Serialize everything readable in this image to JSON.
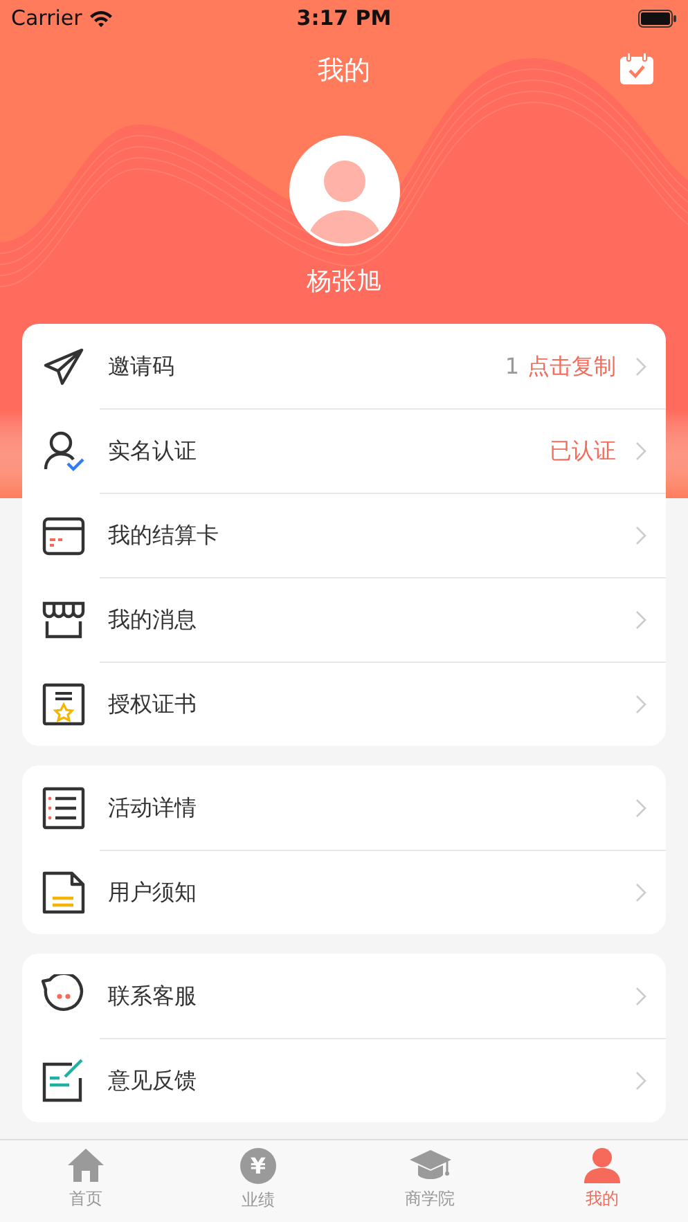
{
  "status_bar": {
    "carrier": "Carrier",
    "time": "3:17 PM"
  },
  "header": {
    "title": "我的",
    "user_name": "杨张旭"
  },
  "groups": [
    {
      "items": [
        {
          "kind": "send",
          "label": "邀请码",
          "values": [
            {
              "text": "1",
              "accent": false
            },
            {
              "text": "点击复制",
              "accent": true
            }
          ]
        },
        {
          "kind": "verify",
          "label": "实名认证",
          "values": [
            {
              "text": "已认证",
              "accent": true
            }
          ]
        },
        {
          "kind": "card",
          "label": "我的结算卡"
        },
        {
          "kind": "shop",
          "label": "我的消息"
        },
        {
          "kind": "cert",
          "label": "授权证书"
        }
      ]
    },
    {
      "items": [
        {
          "kind": "list",
          "label": "活动详情"
        },
        {
          "kind": "doc",
          "label": "用户须知"
        }
      ]
    },
    {
      "items": [
        {
          "kind": "chat",
          "label": "联系客服"
        },
        {
          "kind": "edit",
          "label": "意见反馈"
        }
      ]
    }
  ],
  "tab_bar": [
    {
      "kind": "home",
      "label": "首页",
      "selected": false
    },
    {
      "kind": "coin",
      "label": "业绩",
      "icon_text": "¥",
      "selected": false
    },
    {
      "kind": "cap",
      "label": "商学院",
      "selected": false
    },
    {
      "kind": "person",
      "label": "我的",
      "selected": true
    }
  ]
}
